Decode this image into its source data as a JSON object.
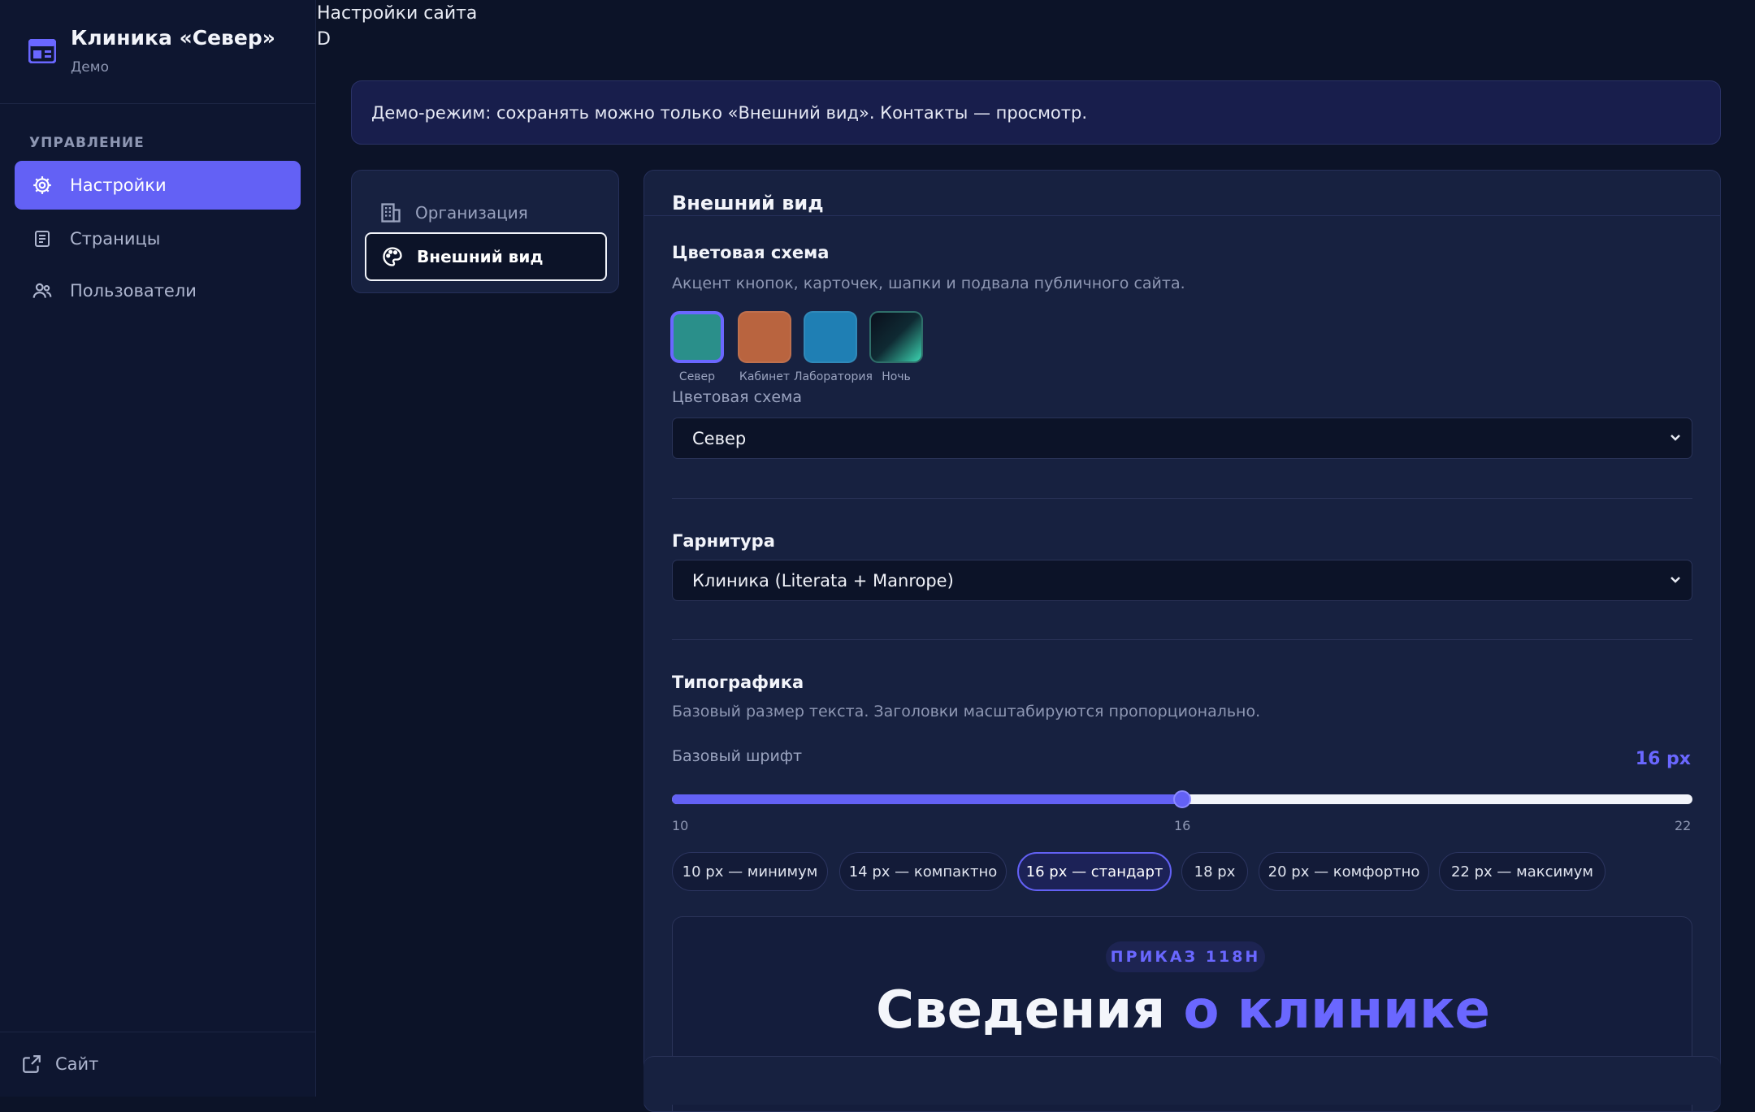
{
  "sidebar": {
    "brand_title": "Клиника «Север»",
    "brand_subtitle": "Демо",
    "section_label": "УПРАВЛЕНИЕ",
    "items": [
      {
        "label": "Настройки",
        "icon": "gear-icon",
        "active": true
      },
      {
        "label": "Страницы",
        "icon": "document-icon",
        "active": false
      },
      {
        "label": "Пользователи",
        "icon": "users-icon",
        "active": false
      }
    ],
    "footer_link": "Сайт"
  },
  "header": {
    "title": "Настройки сайта",
    "user_initial": "D"
  },
  "banner": {
    "text": "Демо-режим: сохранять можно только «Внешний вид». Контакты — просмотр."
  },
  "tabs": [
    {
      "label": "Организация",
      "icon": "building-icon",
      "active": false
    },
    {
      "label": "Внешний вид",
      "icon": "palette-icon",
      "active": true
    }
  ],
  "appearance": {
    "title": "Внешний вид",
    "color_scheme": {
      "heading": "Цветовая схема",
      "description": "Акцент кнопок, карточек, шапки и подвала публичного сайта.",
      "swatches": [
        {
          "label": "Север",
          "color": "#2a8f8a",
          "selected": true
        },
        {
          "label": "Кабинет",
          "color": "#b9643f",
          "selected": false
        },
        {
          "label": "Лаборатория",
          "color": "#1f7fb4",
          "selected": false
        },
        {
          "label": "Ночь",
          "color": "#0b1a24",
          "selected": false
        }
      ],
      "select_label": "Цветовая схема",
      "select_value": "Север"
    },
    "typeface": {
      "heading": "Гарнитура",
      "select_value": "Клиника (Literata + Manrope)"
    },
    "typography": {
      "heading": "Типографика",
      "description": "Базовый размер текста. Заголовки масштабируются пропорционально.",
      "slider_label": "Базовый шрифт",
      "value_text": "16 px",
      "min": 10,
      "max": 22,
      "value": 16,
      "tick_min": "10",
      "tick_mid": "16",
      "tick_max": "22",
      "presets": [
        {
          "label": "10 px — минимум",
          "active": false
        },
        {
          "label": "14 px — компактно",
          "active": false
        },
        {
          "label": "16 px — стандарт",
          "active": true
        },
        {
          "label": "18 px",
          "active": false
        },
        {
          "label": "20 px — комфортно",
          "active": false
        },
        {
          "label": "22 px — максимум",
          "active": false
        }
      ]
    },
    "preview": {
      "badge": "ПРИКАЗ 118Н",
      "heading_main": "Сведения",
      "heading_accent": "о клинике"
    }
  },
  "colors": {
    "accent": "#6361f5",
    "background": "#0c1328",
    "card": "#172140"
  }
}
